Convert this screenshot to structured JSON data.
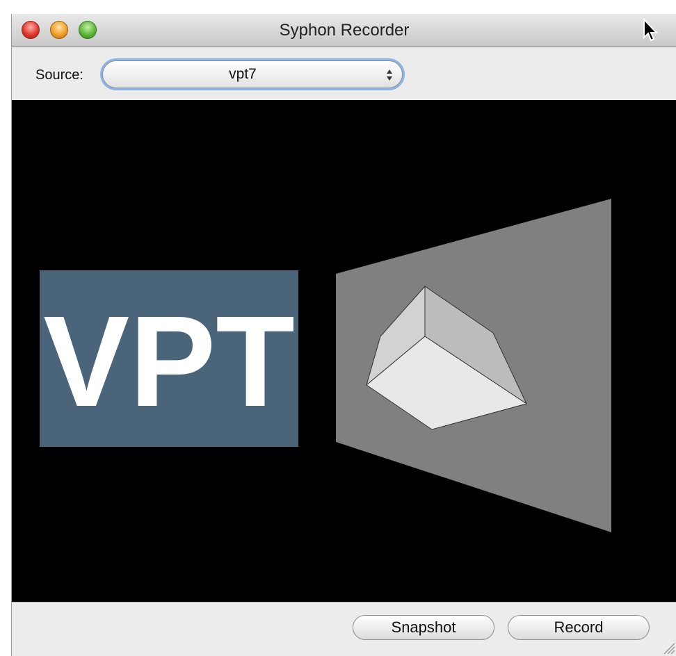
{
  "window": {
    "title": "Syphon Recorder"
  },
  "toolbar": {
    "source_label": "Source:",
    "source_value": "vpt7"
  },
  "preview": {
    "logo_text": "VPT",
    "logo_color": "#4a6479",
    "plane_color": "#808080"
  },
  "actions": {
    "snapshot_label": "Snapshot",
    "record_label": "Record"
  },
  "icons": {
    "close": "close-icon",
    "minimize": "minimize-icon",
    "zoom": "zoom-icon",
    "cursor": "cursor-icon",
    "popup_arrows": "updown-arrows-icon",
    "resize_grip": "resize-grip-icon"
  }
}
